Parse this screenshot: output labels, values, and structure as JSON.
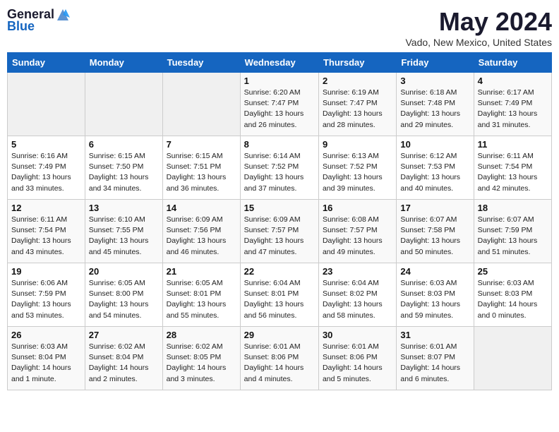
{
  "logo": {
    "general": "General",
    "blue": "Blue"
  },
  "title": "May 2024",
  "location": "Vado, New Mexico, United States",
  "days_of_week": [
    "Sunday",
    "Monday",
    "Tuesday",
    "Wednesday",
    "Thursday",
    "Friday",
    "Saturday"
  ],
  "weeks": [
    [
      {
        "day": "",
        "info": ""
      },
      {
        "day": "",
        "info": ""
      },
      {
        "day": "",
        "info": ""
      },
      {
        "day": "1",
        "info": "Sunrise: 6:20 AM\nSunset: 7:47 PM\nDaylight: 13 hours\nand 26 minutes."
      },
      {
        "day": "2",
        "info": "Sunrise: 6:19 AM\nSunset: 7:47 PM\nDaylight: 13 hours\nand 28 minutes."
      },
      {
        "day": "3",
        "info": "Sunrise: 6:18 AM\nSunset: 7:48 PM\nDaylight: 13 hours\nand 29 minutes."
      },
      {
        "day": "4",
        "info": "Sunrise: 6:17 AM\nSunset: 7:49 PM\nDaylight: 13 hours\nand 31 minutes."
      }
    ],
    [
      {
        "day": "5",
        "info": "Sunrise: 6:16 AM\nSunset: 7:49 PM\nDaylight: 13 hours\nand 33 minutes."
      },
      {
        "day": "6",
        "info": "Sunrise: 6:15 AM\nSunset: 7:50 PM\nDaylight: 13 hours\nand 34 minutes."
      },
      {
        "day": "7",
        "info": "Sunrise: 6:15 AM\nSunset: 7:51 PM\nDaylight: 13 hours\nand 36 minutes."
      },
      {
        "day": "8",
        "info": "Sunrise: 6:14 AM\nSunset: 7:52 PM\nDaylight: 13 hours\nand 37 minutes."
      },
      {
        "day": "9",
        "info": "Sunrise: 6:13 AM\nSunset: 7:52 PM\nDaylight: 13 hours\nand 39 minutes."
      },
      {
        "day": "10",
        "info": "Sunrise: 6:12 AM\nSunset: 7:53 PM\nDaylight: 13 hours\nand 40 minutes."
      },
      {
        "day": "11",
        "info": "Sunrise: 6:11 AM\nSunset: 7:54 PM\nDaylight: 13 hours\nand 42 minutes."
      }
    ],
    [
      {
        "day": "12",
        "info": "Sunrise: 6:11 AM\nSunset: 7:54 PM\nDaylight: 13 hours\nand 43 minutes."
      },
      {
        "day": "13",
        "info": "Sunrise: 6:10 AM\nSunset: 7:55 PM\nDaylight: 13 hours\nand 45 minutes."
      },
      {
        "day": "14",
        "info": "Sunrise: 6:09 AM\nSunset: 7:56 PM\nDaylight: 13 hours\nand 46 minutes."
      },
      {
        "day": "15",
        "info": "Sunrise: 6:09 AM\nSunset: 7:57 PM\nDaylight: 13 hours\nand 47 minutes."
      },
      {
        "day": "16",
        "info": "Sunrise: 6:08 AM\nSunset: 7:57 PM\nDaylight: 13 hours\nand 49 minutes."
      },
      {
        "day": "17",
        "info": "Sunrise: 6:07 AM\nSunset: 7:58 PM\nDaylight: 13 hours\nand 50 minutes."
      },
      {
        "day": "18",
        "info": "Sunrise: 6:07 AM\nSunset: 7:59 PM\nDaylight: 13 hours\nand 51 minutes."
      }
    ],
    [
      {
        "day": "19",
        "info": "Sunrise: 6:06 AM\nSunset: 7:59 PM\nDaylight: 13 hours\nand 53 minutes."
      },
      {
        "day": "20",
        "info": "Sunrise: 6:05 AM\nSunset: 8:00 PM\nDaylight: 13 hours\nand 54 minutes."
      },
      {
        "day": "21",
        "info": "Sunrise: 6:05 AM\nSunset: 8:01 PM\nDaylight: 13 hours\nand 55 minutes."
      },
      {
        "day": "22",
        "info": "Sunrise: 6:04 AM\nSunset: 8:01 PM\nDaylight: 13 hours\nand 56 minutes."
      },
      {
        "day": "23",
        "info": "Sunrise: 6:04 AM\nSunset: 8:02 PM\nDaylight: 13 hours\nand 58 minutes."
      },
      {
        "day": "24",
        "info": "Sunrise: 6:03 AM\nSunset: 8:03 PM\nDaylight: 13 hours\nand 59 minutes."
      },
      {
        "day": "25",
        "info": "Sunrise: 6:03 AM\nSunset: 8:03 PM\nDaylight: 14 hours\nand 0 minutes."
      }
    ],
    [
      {
        "day": "26",
        "info": "Sunrise: 6:03 AM\nSunset: 8:04 PM\nDaylight: 14 hours\nand 1 minute."
      },
      {
        "day": "27",
        "info": "Sunrise: 6:02 AM\nSunset: 8:04 PM\nDaylight: 14 hours\nand 2 minutes."
      },
      {
        "day": "28",
        "info": "Sunrise: 6:02 AM\nSunset: 8:05 PM\nDaylight: 14 hours\nand 3 minutes."
      },
      {
        "day": "29",
        "info": "Sunrise: 6:01 AM\nSunset: 8:06 PM\nDaylight: 14 hours\nand 4 minutes."
      },
      {
        "day": "30",
        "info": "Sunrise: 6:01 AM\nSunset: 8:06 PM\nDaylight: 14 hours\nand 5 minutes."
      },
      {
        "day": "31",
        "info": "Sunrise: 6:01 AM\nSunset: 8:07 PM\nDaylight: 14 hours\nand 6 minutes."
      },
      {
        "day": "",
        "info": ""
      }
    ]
  ]
}
